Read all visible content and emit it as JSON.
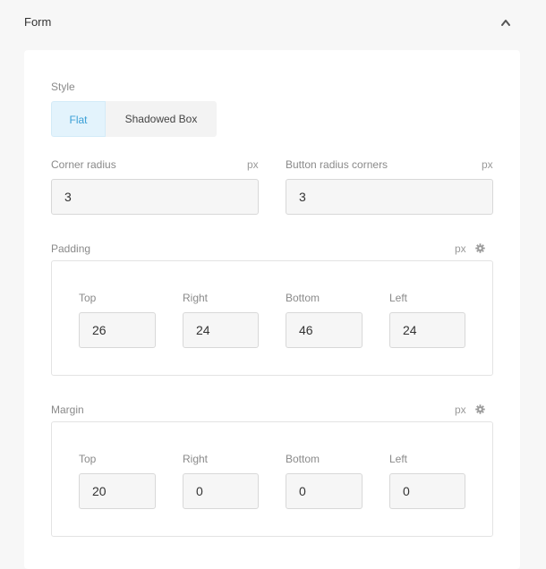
{
  "section": {
    "title": "Form",
    "collapse_icon": "chevron-up-icon"
  },
  "style": {
    "label": "Style",
    "options": [
      {
        "label": "Flat",
        "selected": true
      },
      {
        "label": "Shadowed Box",
        "selected": false
      }
    ]
  },
  "corner_radius": {
    "label": "Corner radius",
    "unit": "px",
    "value": "3"
  },
  "button_radius": {
    "label": "Button radius corners",
    "unit": "px",
    "value": "3"
  },
  "padding": {
    "label": "Padding",
    "unit": "px",
    "settings_icon": "gear-icon",
    "fields": [
      {
        "label": "Top",
        "value": "26"
      },
      {
        "label": "Right",
        "value": "24"
      },
      {
        "label": "Bottom",
        "value": "46"
      },
      {
        "label": "Left",
        "value": "24"
      }
    ]
  },
  "margin": {
    "label": "Margin",
    "unit": "px",
    "settings_icon": "gear-icon",
    "fields": [
      {
        "label": "Top",
        "value": "20"
      },
      {
        "label": "Right",
        "value": "0"
      },
      {
        "label": "Bottom",
        "value": "0"
      },
      {
        "label": "Left",
        "value": "0"
      }
    ]
  },
  "colors": {
    "accent": "#3a9fd6",
    "accent_bg": "#e3f3fc"
  }
}
